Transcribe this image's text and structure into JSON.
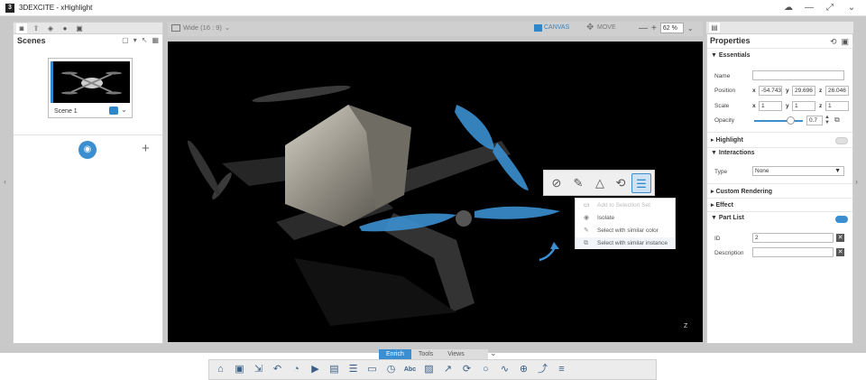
{
  "window": {
    "title": "3DEXCITE - xHighlight",
    "logo": "3",
    "controls": [
      "cloud-icon",
      "minimize-icon",
      "fullscreen-icon",
      "chevron-down-icon"
    ]
  },
  "scenes": {
    "title": "Scenes",
    "scene_name": "Scene 1"
  },
  "viewport": {
    "aspect_label": "Wide (16 : 9)",
    "canvas_label": "CANVAS",
    "move_label": "MOVE",
    "zoom_value": "62 %",
    "axis_label": "Z"
  },
  "context_menu": {
    "items": [
      {
        "label": "Add to Selection Set",
        "icon": "selection-set-icon",
        "disabled": true
      },
      {
        "label": "Isolate",
        "icon": "eye-icon",
        "disabled": false
      },
      {
        "label": "Select with similar color",
        "icon": "brush-icon",
        "disabled": false
      },
      {
        "label": "Select with similar instance",
        "icon": "instance-icon",
        "disabled": false
      }
    ]
  },
  "properties": {
    "title": "Properties",
    "essentials": {
      "heading": "Essentials",
      "name_label": "Name",
      "name_value": "",
      "position_label": "Position",
      "position": {
        "x": "-54.743",
        "y": "29.696",
        "z": "26.046"
      },
      "scale_label": "Scale",
      "scale": {
        "x": "1",
        "y": "1",
        "z": "1"
      },
      "opacity_label": "Opacity",
      "opacity_value": "0.7"
    },
    "highlight": {
      "heading": "Highlight",
      "enabled": false
    },
    "interactions": {
      "heading": "Interactions",
      "type_label": "Type",
      "type_value": "None"
    },
    "custom_rendering": {
      "heading": "Custom Rendering"
    },
    "effect": {
      "heading": "Effect"
    },
    "part_list": {
      "heading": "Part List",
      "enabled": true,
      "id_label": "ID",
      "id_value": "2",
      "description_label": "Description",
      "description_value": ""
    }
  },
  "bottom_tabs": [
    "Enrich",
    "Tools",
    "Views"
  ],
  "colors": {
    "accent": "#3b8fd0",
    "highlight_part": "#2f86c8",
    "viewport_bg": "#000000"
  }
}
